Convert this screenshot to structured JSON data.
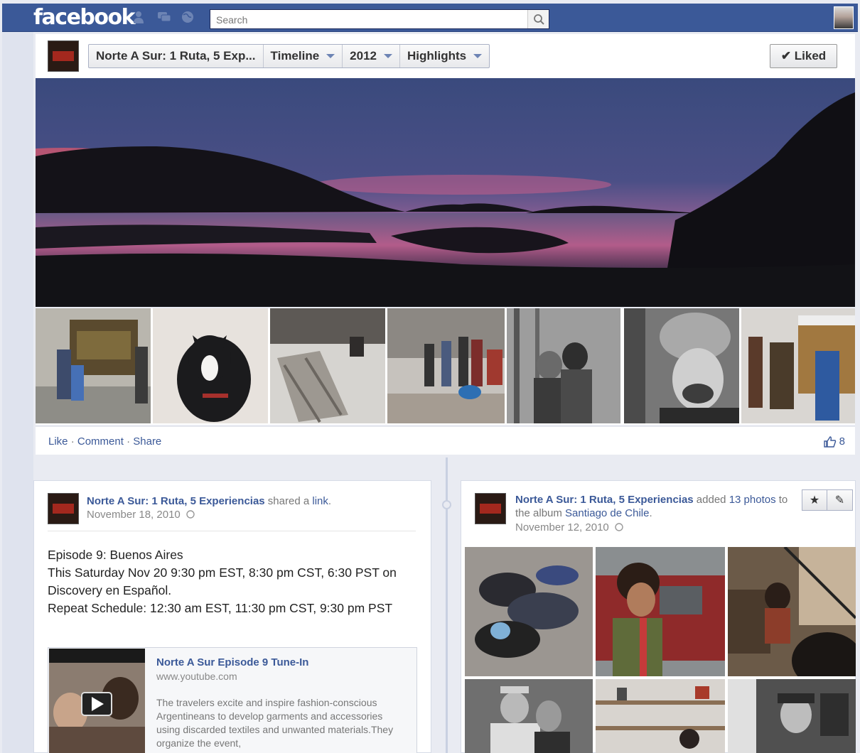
{
  "topbar": {
    "logo": "facebook",
    "search_placeholder": "Search"
  },
  "page_header": {
    "crumbs": [
      {
        "label": "Norte A Sur: 1 Ruta, 5 Exp..."
      },
      {
        "label": "Timeline"
      },
      {
        "label": "2012"
      },
      {
        "label": "Highlights"
      }
    ],
    "liked_label": "✔ Liked"
  },
  "cover_actions": {
    "like": "Like",
    "comment": "Comment",
    "share": "Share",
    "sep": "·",
    "like_count": "8"
  },
  "post_left": {
    "author": "Norte A Sur: 1 Ruta, 5 Experiencias",
    "action": " shared a ",
    "object": "link",
    "date": "November 18, 2010",
    "lines": [
      "Episode 9: Buenos Aires",
      "This Saturday Nov 20 9:30 pm EST, 8:30 pm CST, 6:30 PST on Discovery en Español.",
      "Repeat Schedule: 12:30 am EST, 11:30 pm CST, 9:30 pm PST"
    ],
    "link_card": {
      "title": "Norte A Sur Episode 9 Tune-In",
      "url": "www.youtube.com",
      "description": "The travelers excite and inspire fashion-conscious Argentineans to develop garments and accessories using discarded textiles and unwanted materials.They organize the event,"
    }
  },
  "post_right": {
    "author": "Norte A Sur: 1 Ruta, 5 Experiencias",
    "action": " added ",
    "count_link": "13 photos",
    "to_text": " to the album ",
    "album": "Santiago de Chile",
    "date": "November 12, 2010",
    "star_icon": "★",
    "pencil_icon": "✎"
  }
}
